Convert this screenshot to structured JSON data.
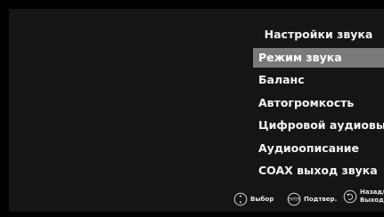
{
  "menu": {
    "title": "Настройки звука",
    "items": [
      {
        "label": "Режим звука",
        "selected": true
      },
      {
        "label": "Баланс",
        "selected": false
      },
      {
        "label": "Автогромкость",
        "selected": false
      },
      {
        "label": "Цифровой аудиовыход",
        "selected": false
      },
      {
        "label": "Аудиоописание",
        "selected": false
      },
      {
        "label": "COAX выход звука",
        "selected": false
      }
    ]
  },
  "footer": {
    "select_label": "Выбор",
    "confirm_label": "Подтвер.",
    "enter_key_text": "ENTER",
    "back_label_line1": "Назад/",
    "back_label_line2": "Выход"
  },
  "colors": {
    "background": "#000000",
    "panel": "#151515",
    "highlight": "#7a7a7a",
    "text": "#ffffff"
  },
  "icons": [
    "dpad-icon",
    "enter-button-icon",
    "back-icon"
  ]
}
